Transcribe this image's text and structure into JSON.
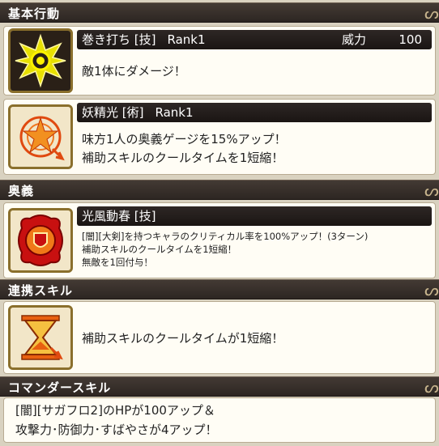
{
  "sections": {
    "basic_action": "基本行動",
    "ougi": "奥義",
    "link_skill": "連携スキル",
    "commander_skill": "コマンダースキル"
  },
  "skills": [
    {
      "name": "巻き打ち [技]",
      "rank": "Rank1",
      "power_label": "威力",
      "power_value": "100",
      "desc": [
        "敵1体にダメージ！"
      ],
      "icon": "starburst-icon"
    },
    {
      "name": "妖精光 [術]",
      "rank": "Rank1",
      "desc": [
        "味方1人の奥義ゲージを15%アップ！",
        "補助スキルのクールタイムを1短縮！"
      ],
      "icon": "magic-circle-icon"
    }
  ],
  "ougi": {
    "name": "光風動春 [技]",
    "desc": [
      "[闇][大剣]を持つキャラのクリティカル率を100%アップ！(3ターン)",
      "補助スキルのクールタイムを1短縮！",
      "無敵を1回付与！"
    ],
    "icon": "shield-burst-icon"
  },
  "link_skill": {
    "desc": "補助スキルのクールタイムが1短縮！",
    "icon": "hourglass-icon"
  },
  "commander": {
    "desc": [
      "[闇][サガフロ2]のHPが100アップ＆",
      "攻撃力･防御力･すばやさが4アップ！"
    ]
  },
  "colors": {
    "header_bg": "#2d2622",
    "card_bg": "#fffdf5",
    "icon_gold": "#8a6f2c"
  }
}
